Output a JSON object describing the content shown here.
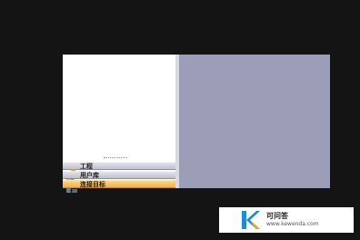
{
  "nav": {
    "items": [
      {
        "label": "工程",
        "icon": "project-icon"
      },
      {
        "label": "用户库",
        "icon": "user-library-icon"
      },
      {
        "label": "连接目标",
        "icon": "connect-target-icon",
        "active": true
      }
    ]
  },
  "watermark": {
    "title": "可问答",
    "url": "www.kewenda.com",
    "logo_color": "#1f8ad6"
  }
}
